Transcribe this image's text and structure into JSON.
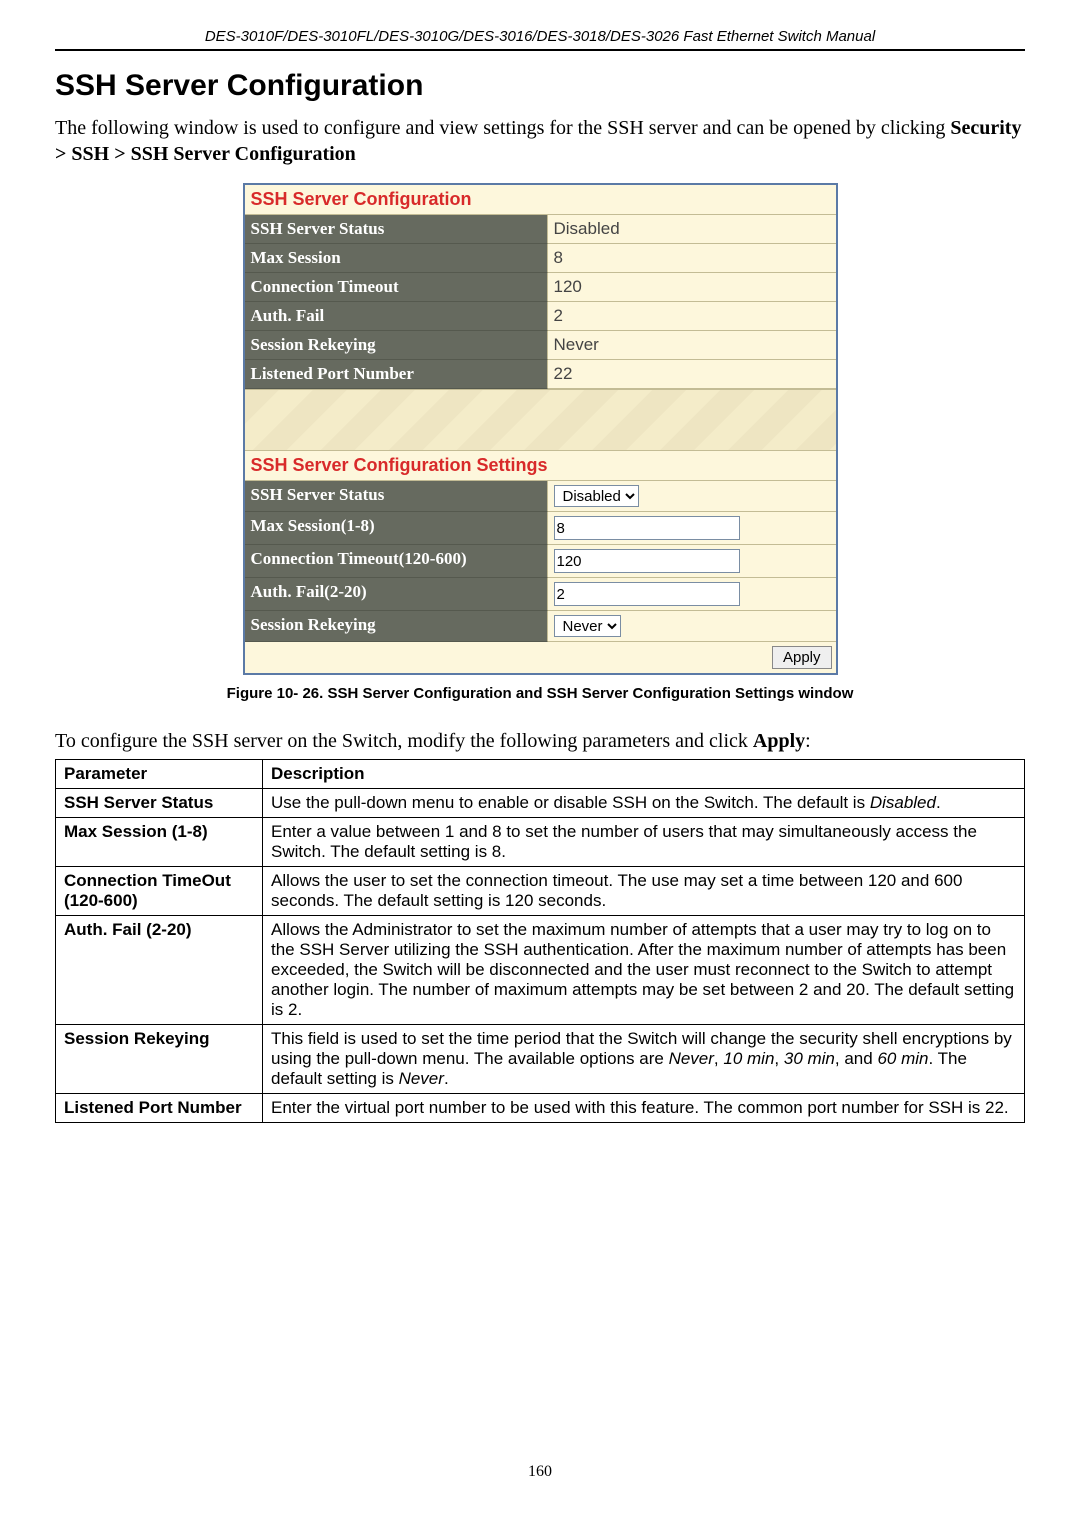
{
  "header": "DES-3010F/DES-3010FL/DES-3010G/DES-3016/DES-3018/DES-3026 Fast Ethernet Switch Manual",
  "title": "SSH Server Configuration",
  "intro_parts": {
    "p1": "The following window is used to configure and view settings for the SSH server and can be opened by clicking ",
    "breadcrumb": "Security > SSH > SSH Server Configuration"
  },
  "figure": {
    "top_title": "SSH Server Configuration",
    "top_rows": [
      {
        "label": "SSH Server Status",
        "value": "Disabled"
      },
      {
        "label": "Max Session",
        "value": "8"
      },
      {
        "label": "Connection Timeout",
        "value": "120"
      },
      {
        "label": "Auth. Fail",
        "value": "2"
      },
      {
        "label": "Session Rekeying",
        "value": "Never"
      },
      {
        "label": "Listened Port Number",
        "value": "22"
      }
    ],
    "settings_title": "SSH Server Configuration Settings",
    "settings_rows": {
      "status": {
        "label": "SSH Server Status",
        "value": "Disabled"
      },
      "max_session": {
        "label": "Max Session(1-8)",
        "value": "8"
      },
      "conn_timeout": {
        "label": "Connection Timeout(120-600)",
        "value": "120"
      },
      "auth_fail": {
        "label": "Auth. Fail(2-20)",
        "value": "2"
      },
      "rekeying": {
        "label": "Session Rekeying",
        "value": "Never"
      }
    },
    "apply_label": "Apply",
    "caption": "Figure 10- 26. SSH Server Configuration and SSH Server Configuration Settings window"
  },
  "before_table": {
    "text": "To configure the SSH server on the Switch, modify the following parameters and click ",
    "bold": "Apply",
    "tail": ":"
  },
  "param_table": {
    "head": {
      "param": "Parameter",
      "desc": "Description"
    },
    "rows": [
      {
        "param": "SSH Server Status",
        "desc_pre": "Use the pull-down menu to enable or disable SSH on the Switch. The default is ",
        "italic1": "Disabled",
        "desc_post": "."
      },
      {
        "param": "Max Session (1-8)",
        "desc": "Enter a value between 1 and 8 to set the number of users that may simultaneously access the Switch. The default setting is 8."
      },
      {
        "param": "Connection TimeOut (120-600)",
        "desc": "Allows the user to set the connection timeout. The use may set a time between 120 and 600 seconds. The default setting is 120 seconds."
      },
      {
        "param": "Auth. Fail (2-20)",
        "desc": "Allows the Administrator to set the maximum number of attempts that a user may try to log on to the SSH Server utilizing the SSH authentication. After the maximum number of attempts has been exceeded, the Switch will be disconnected and the user must reconnect to the Switch to attempt another login. The number of maximum attempts may be set between 2 and 20. The default setting is 2."
      },
      {
        "param": "Session Rekeying",
        "desc_pre": "This field is used to set the time period that the Switch will change the security shell encryptions by using the pull-down menu. The available options are ",
        "i1": "Never",
        "sep1": ", ",
        "i2": "10 min",
        "sep2": ", ",
        "i3": "30 min",
        "sep3": ", and ",
        "i4": "60 min",
        "desc_mid": ". The default setting is ",
        "i5": "Never",
        "desc_post": "."
      },
      {
        "param": "Listened Port Number",
        "desc": "Enter the virtual port number to be used with this feature. The common port number for SSH is 22."
      }
    ]
  },
  "page_number": "160"
}
